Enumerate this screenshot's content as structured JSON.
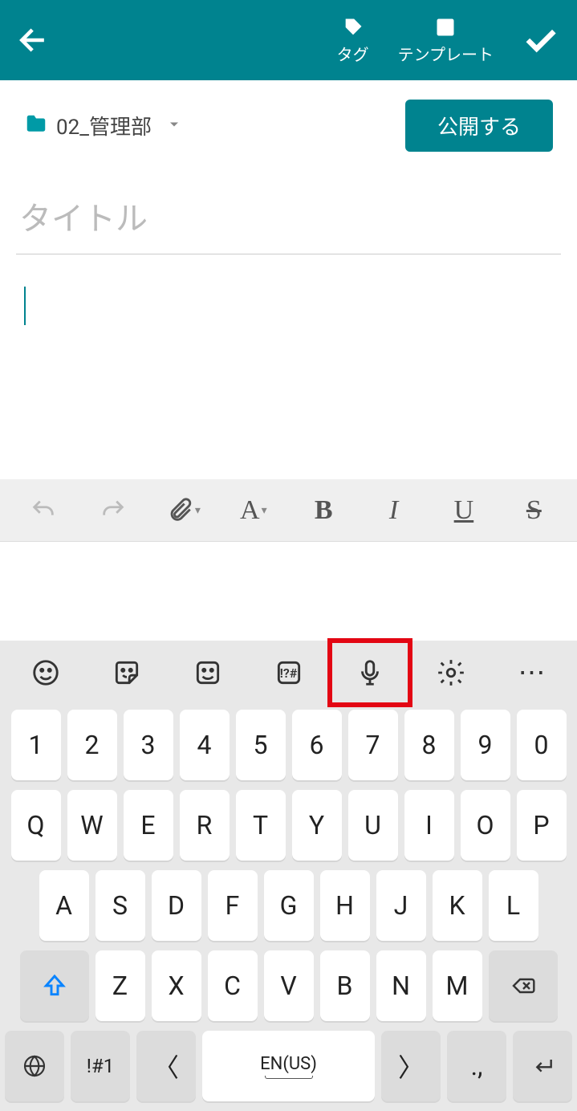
{
  "appbar": {
    "tag_label": "タグ",
    "template_label": "テンプレート"
  },
  "folder": {
    "name": "02_管理部"
  },
  "publish_label": "公開する",
  "title_placeholder": "タイトル",
  "keyboard": {
    "space_label": "EN(US)",
    "sym_label": "!#1",
    "hash_label": "!?#",
    "dot_label": ".,",
    "row_num": [
      "1",
      "2",
      "3",
      "4",
      "5",
      "6",
      "7",
      "8",
      "9",
      "0"
    ],
    "row_q": [
      "Q",
      "W",
      "E",
      "R",
      "T",
      "Y",
      "U",
      "I",
      "O",
      "P"
    ],
    "row_a": [
      "A",
      "S",
      "D",
      "F",
      "G",
      "H",
      "J",
      "K",
      "L"
    ],
    "row_z": [
      "Z",
      "X",
      "C",
      "V",
      "B",
      "N",
      "M"
    ]
  }
}
